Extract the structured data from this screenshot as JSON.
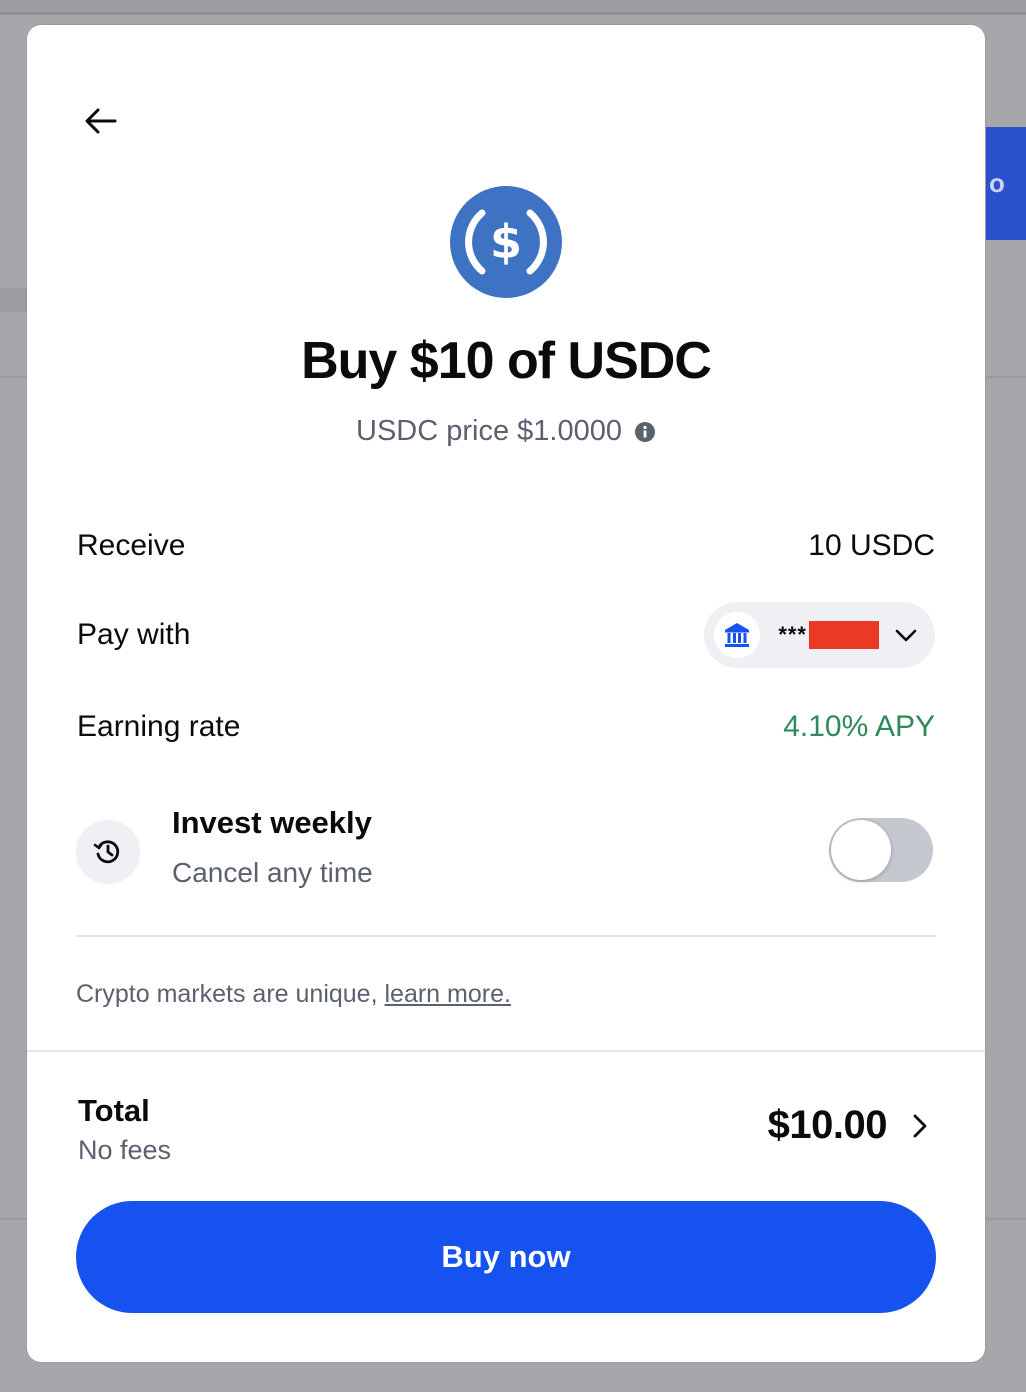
{
  "background": {
    "peek_char": "o"
  },
  "header": {
    "title": "Buy $10 of USDC",
    "price_line": "USDC price $1.0000"
  },
  "asset": {
    "icon": "usdc-coin-icon",
    "brand_color": "#3e73c4"
  },
  "details": {
    "receive_label": "Receive",
    "receive_value": "10 USDC",
    "pay_with_label": "Pay with",
    "pay_with_masked": "***",
    "earning_label": "Earning rate",
    "earning_value": "4.10% APY"
  },
  "invest": {
    "title": "Invest weekly",
    "subtitle": "Cancel any time",
    "enabled": false
  },
  "disclaimer": {
    "text": "Crypto markets are unique, ",
    "link": "learn more."
  },
  "footer": {
    "total_label": "Total",
    "total_sub": "No fees",
    "total_amount": "$10.00",
    "buy_label": "Buy now"
  },
  "colors": {
    "primary": "#1652f0",
    "positive": "#2e8a57",
    "muted": "#5b616e",
    "redaction": "#ea3a26"
  }
}
